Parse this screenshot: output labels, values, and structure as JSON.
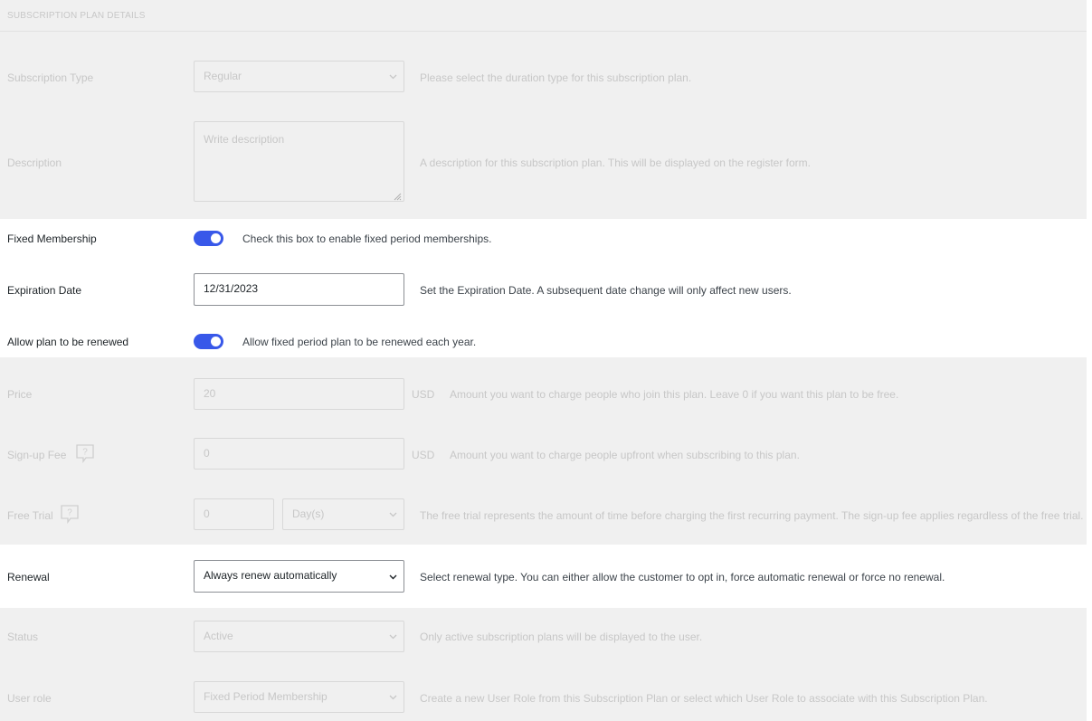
{
  "section": {
    "title": "SUBSCRIPTION PLAN DETAILS"
  },
  "subscription_type": {
    "label": "Subscription Type",
    "value": "Regular",
    "help": "Please select the duration type for this subscription plan."
  },
  "description": {
    "label": "Description",
    "placeholder": "Write description",
    "help": "A description for this subscription plan. This will be displayed on the register form."
  },
  "fixed_membership": {
    "label": "Fixed Membership",
    "enabled": true,
    "help": "Check this box to enable fixed period memberships."
  },
  "expiration_date": {
    "label": "Expiration Date",
    "value": "12/31/2023",
    "help": "Set the Expiration Date. A subsequent date change will only affect new users."
  },
  "allow_renew": {
    "label": "Allow plan to be renewed",
    "enabled": true,
    "help": "Allow fixed period plan to be renewed each year."
  },
  "price": {
    "label": "Price",
    "value": "20",
    "unit": "USD",
    "help": "Amount you want to charge people who join this plan. Leave 0 if you want this plan to be free."
  },
  "signup_fee": {
    "label": "Sign-up Fee",
    "value": "0",
    "unit": "USD",
    "help": "Amount you want to charge people upfront when subscribing to this plan."
  },
  "free_trial": {
    "label": "Free Trial",
    "value": "0",
    "unit_value": "Day(s)",
    "help": "The free trial represents the amount of time before charging the first recurring payment. The sign-up fee applies regardless of the free trial."
  },
  "renewal": {
    "label": "Renewal",
    "value": "Always renew automatically",
    "help": "Select renewal type. You can either allow the customer to opt in, force automatic renewal or force no renewal."
  },
  "status": {
    "label": "Status",
    "value": "Active",
    "help": "Only active subscription plans will be displayed to the user."
  },
  "user_role": {
    "label": "User role",
    "value": "Fixed Period Membership",
    "help": "Create a new User Role from this Subscription Plan or select which User Role to associate with this Subscription Plan."
  },
  "colors": {
    "toggle_on": "#3858e9",
    "disabled_bg": "#f0f0f0",
    "disabled_text": "#c7c7c7"
  }
}
